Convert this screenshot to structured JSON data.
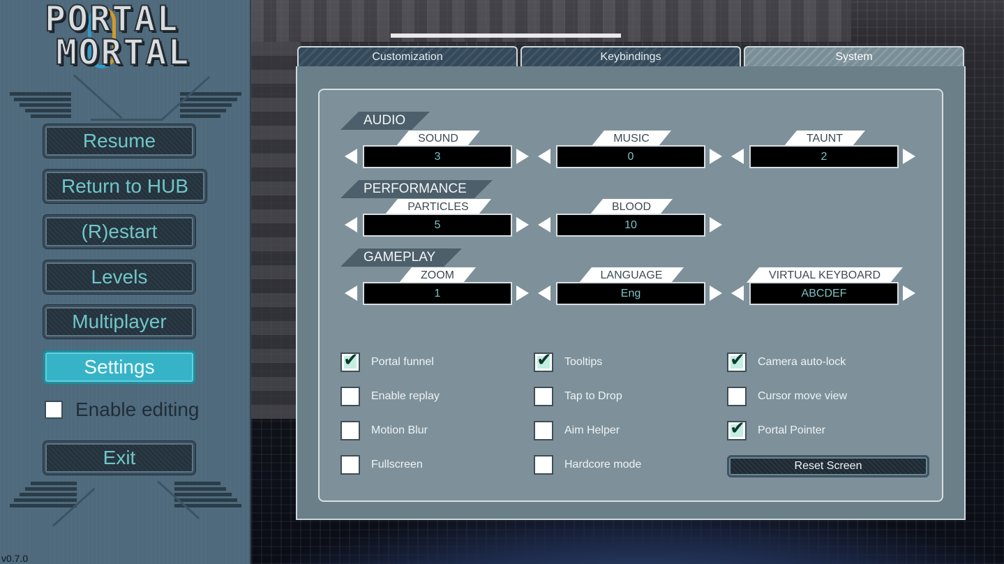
{
  "logo": {
    "line1": "PORTAL",
    "line2": "MORTAL"
  },
  "menu": {
    "resume": "Resume",
    "return_hub": "Return to HUB",
    "restart": "(R)estart",
    "levels": "Levels",
    "multiplayer": "Multiplayer",
    "settings": "Settings",
    "enable_editing": "Enable editing",
    "enable_editing_checked": false,
    "exit": "Exit",
    "active": "Settings"
  },
  "version": "v0.7.0",
  "tabs": [
    {
      "label": "Customization",
      "active": false
    },
    {
      "label": "Keybindings",
      "active": false
    },
    {
      "label": "System",
      "active": true
    }
  ],
  "sections": {
    "audio": {
      "title": "AUDIO",
      "options": [
        {
          "label": "SOUND",
          "value": "3"
        },
        {
          "label": "MUSIC",
          "value": "0"
        },
        {
          "label": "TAUNT",
          "value": "2"
        }
      ]
    },
    "performance": {
      "title": "PERFORMANCE",
      "options": [
        {
          "label": "PARTICLES",
          "value": "5"
        },
        {
          "label": "BLOOD",
          "value": "10"
        }
      ]
    },
    "gameplay": {
      "title": "GAMEPLAY",
      "options": [
        {
          "label": "ZOOM",
          "value": "1"
        },
        {
          "label": "LANGUAGE",
          "value": "Eng"
        },
        {
          "label": "VIRTUAL KEYBOARD",
          "value": "ABCDEF"
        }
      ]
    }
  },
  "checkboxes": [
    {
      "label": "Portal funnel",
      "checked": true
    },
    {
      "label": "Tooltips",
      "checked": true
    },
    {
      "label": "Camera auto-lock",
      "checked": true
    },
    {
      "label": "Enable replay",
      "checked": false
    },
    {
      "label": "Tap to Drop",
      "checked": false
    },
    {
      "label": "Cursor move view",
      "checked": false
    },
    {
      "label": "Motion Blur",
      "checked": false
    },
    {
      "label": "Aim Helper",
      "checked": false
    },
    {
      "label": "Portal Pointer",
      "checked": true
    },
    {
      "label": "Fullscreen",
      "checked": false
    },
    {
      "label": "Hardcore mode",
      "checked": false
    }
  ],
  "reset_screen": "Reset Screen",
  "colors": {
    "accent": "#36b3c7",
    "menu_text": "#6fc7c9",
    "value_text": "#7fc3c6",
    "panel": "#7e919a"
  }
}
